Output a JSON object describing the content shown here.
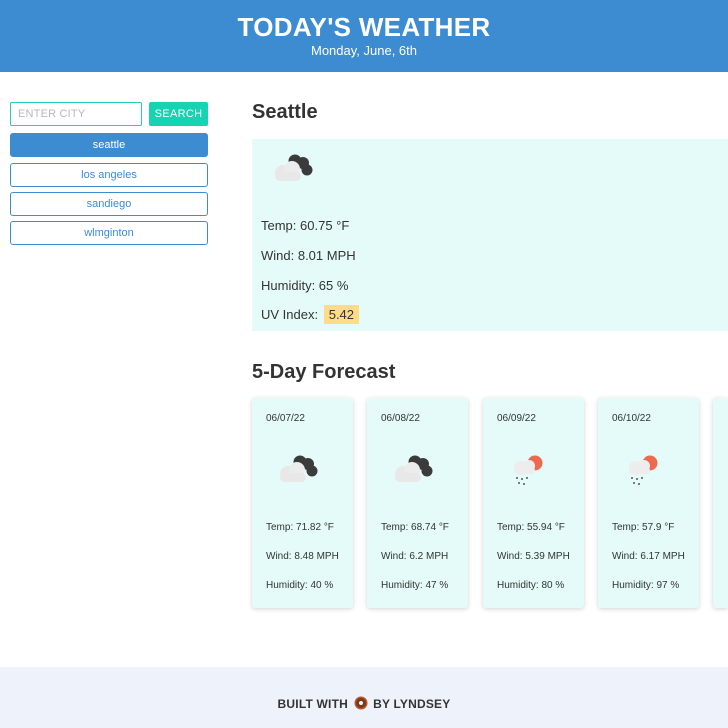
{
  "header": {
    "title": "TODAY'S WEATHER",
    "date": "Monday, June, 6th"
  },
  "search": {
    "placeholder": "ENTER CITY",
    "button_label": "SEARCH"
  },
  "history": [
    {
      "label": "seattle",
      "active": true
    },
    {
      "label": "los angeles",
      "active": false
    },
    {
      "label": "sandiego",
      "active": false
    },
    {
      "label": "wlmginton",
      "active": false
    }
  ],
  "current": {
    "city": "Seattle",
    "icon": "cloudy-icon",
    "temp": "Temp: 60.75 °F",
    "wind": "Wind: 8.01 MPH",
    "humidity": "Humidity: 65 %",
    "uv_label": "UV Index:",
    "uv_value": "5.42"
  },
  "forecast": {
    "title": "5-Day Forecast",
    "days": [
      {
        "date": "06/07/22",
        "icon": "cloudy-icon",
        "temp": "Temp: 71.82 °F",
        "wind": "Wind: 8.48 MPH",
        "humidity": "Humidity: 40 %"
      },
      {
        "date": "06/08/22",
        "icon": "cloudy-icon",
        "temp": "Temp: 68.74 °F",
        "wind": "Wind: 6.2 MPH",
        "humidity": "Humidity: 47 %"
      },
      {
        "date": "06/09/22",
        "icon": "rain-sun-icon",
        "temp": "Temp: 55.94 °F",
        "wind": "Wind: 5.39 MPH",
        "humidity": "Humidity: 80 %"
      },
      {
        "date": "06/10/22",
        "icon": "rain-sun-icon",
        "temp": "Temp: 57.9 °F",
        "wind": "Wind: 6.17 MPH",
        "humidity": "Humidity: 97 %"
      }
    ]
  },
  "footer": {
    "prefix": "BUILT WITH",
    "suffix": "BY LYNDSEY",
    "icon": "donut-icon"
  },
  "colors": {
    "header": "#3d8bd1",
    "accent": "#16d3b1",
    "card": "#e4fbf9",
    "uv": "#fddc88",
    "footer": "#eef3fb"
  }
}
